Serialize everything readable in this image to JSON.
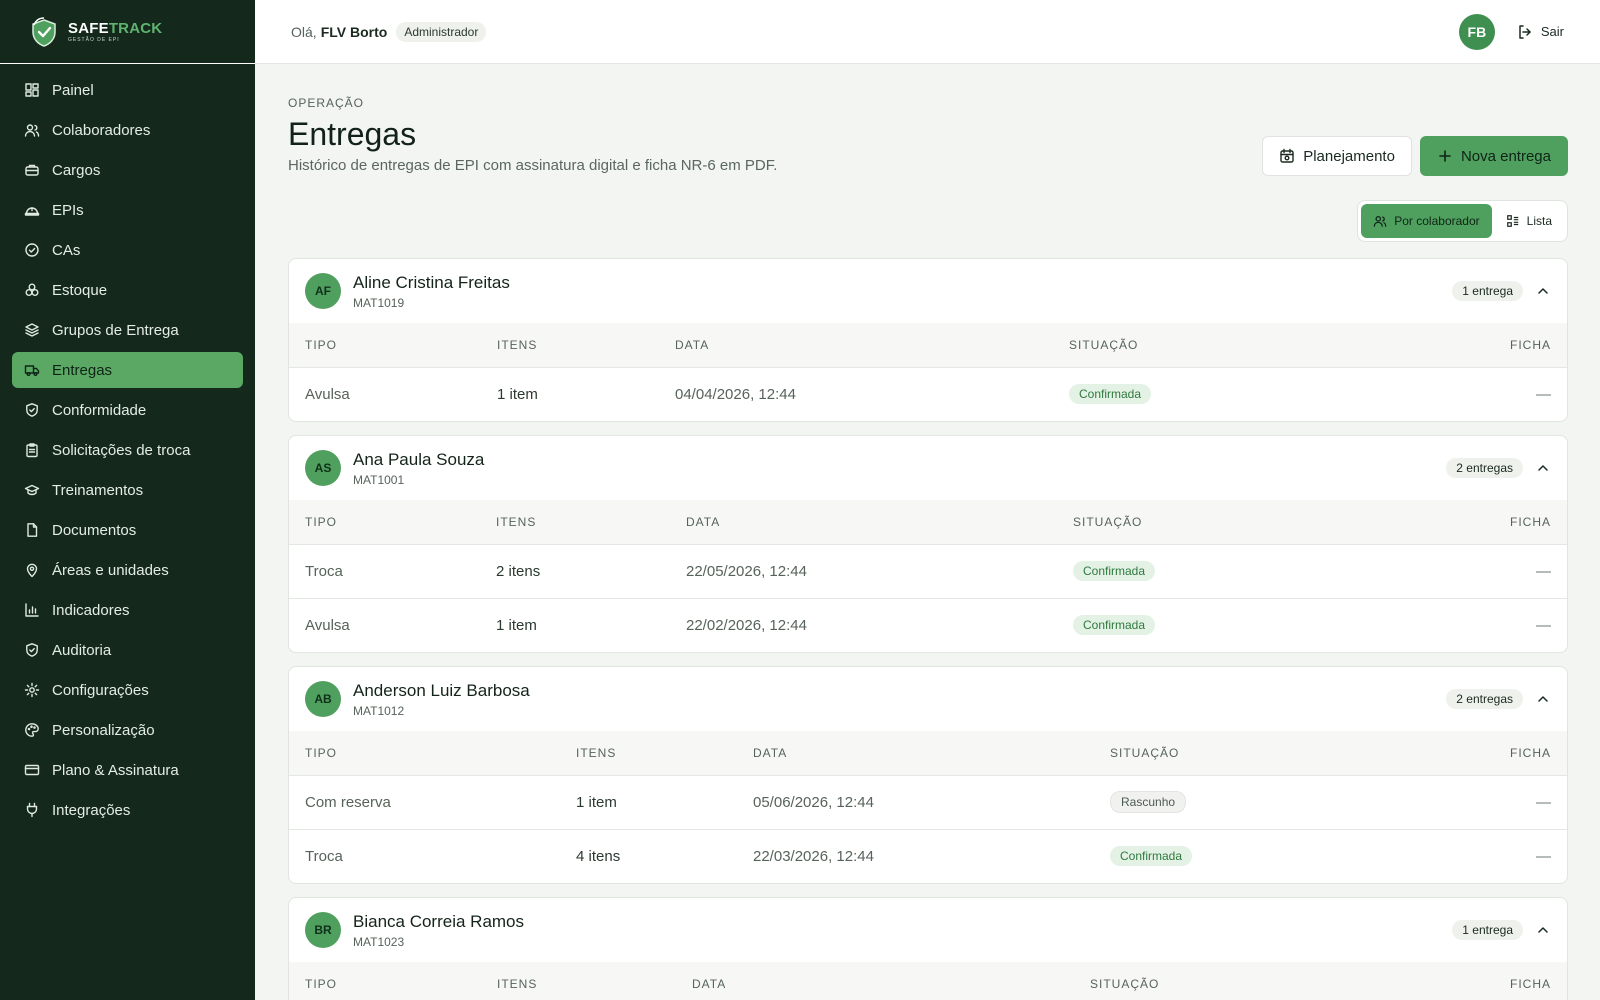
{
  "brand": {
    "name_a": "SAFE",
    "name_b": "TRACK",
    "tagline": "GESTÃO DE EPI"
  },
  "colors": {
    "sidebar": "#14281c",
    "accent": "#4fa05e",
    "confirmed_text": "#2e7a3e"
  },
  "sidebar": {
    "items": [
      {
        "label": "Painel",
        "icon": "dashboard-icon"
      },
      {
        "label": "Colaboradores",
        "icon": "users-icon"
      },
      {
        "label": "Cargos",
        "icon": "briefcase-icon"
      },
      {
        "label": "EPIs",
        "icon": "helmet-icon"
      },
      {
        "label": "CAs",
        "icon": "check-circle-icon"
      },
      {
        "label": "Estoque",
        "icon": "boxes-icon"
      },
      {
        "label": "Grupos de Entrega",
        "icon": "layers-icon"
      },
      {
        "label": "Entregas",
        "icon": "truck-icon",
        "active": true
      },
      {
        "label": "Conformidade",
        "icon": "shield-check-icon"
      },
      {
        "label": "Solicitações de troca",
        "icon": "clipboard-icon"
      },
      {
        "label": "Treinamentos",
        "icon": "graduation-cap-icon"
      },
      {
        "label": "Documentos",
        "icon": "file-icon"
      },
      {
        "label": "Áreas e unidades",
        "icon": "map-pin-icon"
      },
      {
        "label": "Indicadores",
        "icon": "bar-chart-icon"
      },
      {
        "label": "Auditoria",
        "icon": "shield-icon"
      },
      {
        "label": "Configurações",
        "icon": "gear-icon"
      },
      {
        "label": "Personalização",
        "icon": "palette-icon"
      },
      {
        "label": "Plano & Assinatura",
        "icon": "credit-card-icon"
      },
      {
        "label": "Integrações",
        "icon": "plug-icon"
      }
    ]
  },
  "header": {
    "greeting": "Olá,",
    "user_name": "FLV Borto",
    "role": "Administrador",
    "avatar_initials": "FB",
    "logout_label": "Sair"
  },
  "page": {
    "eyebrow": "OPERAÇÃO",
    "title": "Entregas",
    "subtitle": "Histórico de entregas de EPI com assinatura digital e ficha NR-6 em PDF.",
    "planning_label": "Planejamento",
    "new_label": "Nova entrega",
    "view_by_employee": "Por colaborador",
    "view_list": "Lista"
  },
  "columns": {
    "tipo": "TIPO",
    "itens": "ITENS",
    "data": "DATA",
    "situacao": "SITUAÇÃO",
    "ficha": "FICHA"
  },
  "groups": [
    {
      "initials": "AF",
      "name": "Aline Cristina Freitas",
      "mat": "MAT1019",
      "count": "1 entrega",
      "cols": [
        "192px",
        "178px",
        "394px"
      ],
      "rows": [
        {
          "tipo": "Avulsa",
          "itens": "1 item",
          "data": "04/04/2026, 12:44",
          "situacao": "Confirmada",
          "status": "ok",
          "ficha": "—"
        }
      ]
    },
    {
      "initials": "AS",
      "name": "Ana Paula Souza",
      "mat": "MAT1001",
      "count": "2 entregas",
      "cols": [
        "191px",
        "190px",
        "387px"
      ],
      "rows": [
        {
          "tipo": "Troca",
          "itens": "2 itens",
          "data": "22/05/2026, 12:44",
          "situacao": "Confirmada",
          "status": "ok",
          "ficha": "—"
        },
        {
          "tipo": "Avulsa",
          "itens": "1 item",
          "data": "22/02/2026, 12:44",
          "situacao": "Confirmada",
          "status": "ok",
          "ficha": "—"
        }
      ]
    },
    {
      "initials": "AB",
      "name": "Anderson Luiz Barbosa",
      "mat": "MAT1012",
      "count": "2 entregas",
      "cols": [
        "271px",
        "177px",
        "357px"
      ],
      "rows": [
        {
          "tipo": "Com reserva",
          "itens": "1 item",
          "data": "05/06/2026, 12:44",
          "situacao": "Rascunho",
          "status": "draft",
          "ficha": "—"
        },
        {
          "tipo": "Troca",
          "itens": "4 itens",
          "data": "22/03/2026, 12:44",
          "situacao": "Confirmada",
          "status": "ok",
          "ficha": "—"
        }
      ]
    },
    {
      "initials": "BR",
      "name": "Bianca Correia Ramos",
      "mat": "MAT1023",
      "count": "1 entrega",
      "cols": [
        "192px",
        "195px",
        "398px"
      ],
      "rows": []
    }
  ]
}
